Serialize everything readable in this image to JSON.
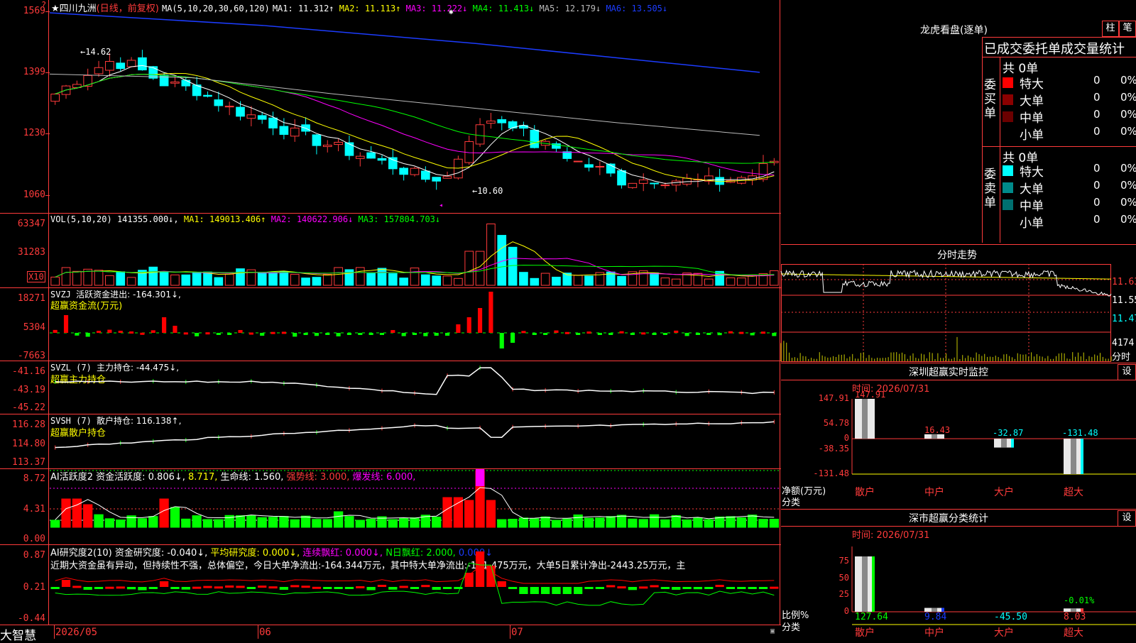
{
  "app": {
    "name": "大智慧"
  },
  "header": {
    "star": "★",
    "stock": "四川九洲",
    "period": "(日线，前复权)",
    "ma_label": "MA(5,10,20,30,60,120)",
    "ma": [
      {
        "t": "MA1: 11.312↑",
        "c": "#ffffff"
      },
      {
        "t": "MA2: 11.113↑",
        "c": "#ffff00"
      },
      {
        "t": "MA3: 11.222↓",
        "c": "#ff00ff"
      },
      {
        "t": "MA4: 11.413↓",
        "c": "#00ff00"
      },
      {
        "t": "MA5: 12.179↓",
        "c": "#bbbbbb"
      },
      {
        "t": "MA6: 13.505↓",
        "c": "#1c3cff"
      }
    ]
  },
  "price": {
    "yticks": [
      {
        "t": "1569",
        "v": 15.69
      },
      {
        "t": "1399",
        "v": 13.99
      },
      {
        "t": "1230",
        "v": 12.3
      },
      {
        "t": "1060",
        "v": 10.6
      }
    ],
    "high_label": "←14.62",
    "low_label": "←10.60"
  },
  "vol": {
    "label": "VOL(5,10,20)",
    "value": "141355.000↓",
    "ma": [
      {
        "t": "MA1: 149013.406↑",
        "c": "#ffff00"
      },
      {
        "t": "MA2: 140622.906↓",
        "c": "#ff00ff"
      },
      {
        "t": "MA3: 157804.703↓",
        "c": "#00ff00"
      }
    ],
    "yticks": [
      "63347",
      "31283"
    ],
    "unit": "X10"
  },
  "svzj": {
    "label": "SVZJ",
    "line1": "活跃资金进出: -164.301↓,",
    "line2": "超赢资金流(万元)",
    "yticks": [
      "18271",
      "5304",
      "-7663"
    ]
  },
  "svzl": {
    "label": "SVZL (7)",
    "line1": "主力持仓: -44.475↓,",
    "line2": "超赢主力持仓",
    "yticks": [
      "-41.16",
      "-43.19",
      "-45.22"
    ]
  },
  "svsh": {
    "label": "SVSH (7)",
    "line1": "散户持仓: 116.138↑,",
    "line2": "超赢散户持仓",
    "yticks": [
      "116.28",
      "114.80",
      "113.37"
    ]
  },
  "ai1": {
    "label": "AI活跃度2",
    "parts": [
      {
        "t": "资金活跃度: 0.806↓,",
        "c": "#ffffff"
      },
      {
        "t": "8.717,",
        "c": "#ffff00"
      },
      {
        "t": "生命线: 1.560,",
        "c": "#ffffff"
      },
      {
        "t": "强势线: 3.000,",
        "c": "#ff3b3b"
      },
      {
        "t": "爆发线: 6.000,",
        "c": "#ff00ff"
      }
    ],
    "yticks": [
      "8.72",
      "4.31",
      "0.00"
    ]
  },
  "ai2": {
    "label": "AI研究度2(10)",
    "parts": [
      {
        "t": "资金研究度: -0.040↓,",
        "c": "#ffffff"
      },
      {
        "t": "平均研究度: 0.000↓,",
        "c": "#ffff00"
      },
      {
        "t": "连续飘红: 0.000↓,",
        "c": "#ff00ff"
      },
      {
        "t": "N日飘红: 2.000,",
        "c": "#00ff00"
      },
      {
        "t": "0.000↓",
        "c": "#1c3cff"
      }
    ],
    "comment": "近期大资金虽有异动，但持续性不强，总体偏空，今日大单净流出:-164.344万元，其中特大单净流出:-131.475万元，大单5日累计净出-2443.25万元，主",
    "yticks": [
      "0.87",
      "0.21",
      "-0.44"
    ]
  },
  "xaxis": [
    "2026/05",
    "06",
    "07"
  ],
  "right": {
    "lhkp": {
      "title": "龙虎看盘(逐单)",
      "btn1": "柱",
      "btn2": "笔",
      "subtitle": "已成交委托单成交量统计",
      "buy": {
        "side": "委买单",
        "total": "共 0单",
        "rows": [
          {
            "name": "特大",
            "val": "0",
            "pct": "0%",
            "color": "#ff0000"
          },
          {
            "name": "大单",
            "val": "0",
            "pct": "0%",
            "color": "#8b0000"
          },
          {
            "name": "中单",
            "val": "0",
            "pct": "0%",
            "color": "#6b0000"
          },
          {
            "name": "小单",
            "val": "0",
            "pct": "0%",
            "color": ""
          }
        ]
      },
      "sell": {
        "side": "委卖单",
        "total": "共 0单",
        "rows": [
          {
            "name": "特大",
            "val": "0",
            "pct": "0%",
            "color": "#00ffff"
          },
          {
            "name": "大单",
            "val": "0",
            "pct": "0%",
            "color": "#008b8b"
          },
          {
            "name": "中单",
            "val": "0",
            "pct": "0%",
            "color": "#007070"
          },
          {
            "name": "小单",
            "val": "0",
            "pct": "0%",
            "color": ""
          }
        ]
      }
    },
    "intraday": {
      "title": "分时走势",
      "ylabels": [
        "11.63",
        "11.55",
        "11.47"
      ],
      "vol_label": "4174",
      "unit": "分时"
    },
    "monitor": {
      "title": "深圳超赢实时监控",
      "setting": "设",
      "time": "时间: 2026/07/31",
      "yticks": [
        "147.91",
        "54.78",
        "0",
        "-38.35",
        "-131.48"
      ],
      "ylabel": "净额(万元)",
      "cat_label": "分类",
      "bars": [
        {
          "cat": "散户",
          "val": 147.91,
          "label": "147.91"
        },
        {
          "cat": "中户",
          "val": 16.43,
          "label": "16.43"
        },
        {
          "cat": "大户",
          "val": -32.87,
          "label": "-32.87"
        },
        {
          "cat": "超大",
          "val": -131.48,
          "label": "-131.48"
        }
      ]
    },
    "classify": {
      "title": "深市超赢分类统计",
      "setting": "设",
      "time": "时间: 2026/07/31",
      "yticks": [
        "75",
        "50",
        "25",
        "0"
      ],
      "ylabel": "比例%",
      "cat_label": "分类",
      "top_label": "-0.01%",
      "items": [
        {
          "cat": "散户",
          "val": "127.64",
          "ratio": 100
        },
        {
          "cat": "中户",
          "val": "9.84",
          "ratio": 7
        },
        {
          "cat": "大户",
          "val": "-45.50",
          "ratio": 0
        },
        {
          "cat": "超大",
          "val": "8.03",
          "ratio": 6
        }
      ]
    }
  }
}
